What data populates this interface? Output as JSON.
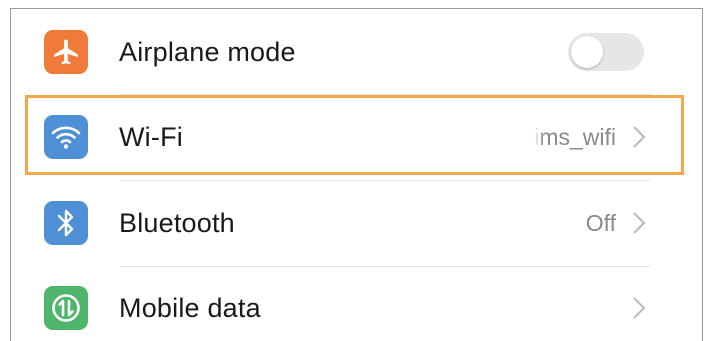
{
  "settings": {
    "airplane": {
      "label": "Airplane mode",
      "toggle_on": false,
      "icon": "airplane-icon",
      "icon_color": "#ef7a3a"
    },
    "wifi": {
      "label": "Wi-Fi",
      "value": "ims_wifi",
      "icon": "wifi-icon",
      "icon_color": "#4f8fd6"
    },
    "bluetooth": {
      "label": "Bluetooth",
      "value": "Off",
      "icon": "bluetooth-icon",
      "icon_color": "#4f8fd6"
    },
    "mobile_data": {
      "label": "Mobile data",
      "icon": "mobile-data-icon",
      "icon_color": "#4fb56a"
    }
  },
  "colors": {
    "highlight_border": "#f2a84a",
    "label_text": "#1a1a1a",
    "value_text": "#8a8a8a",
    "chevron": "#b8b8b8"
  }
}
